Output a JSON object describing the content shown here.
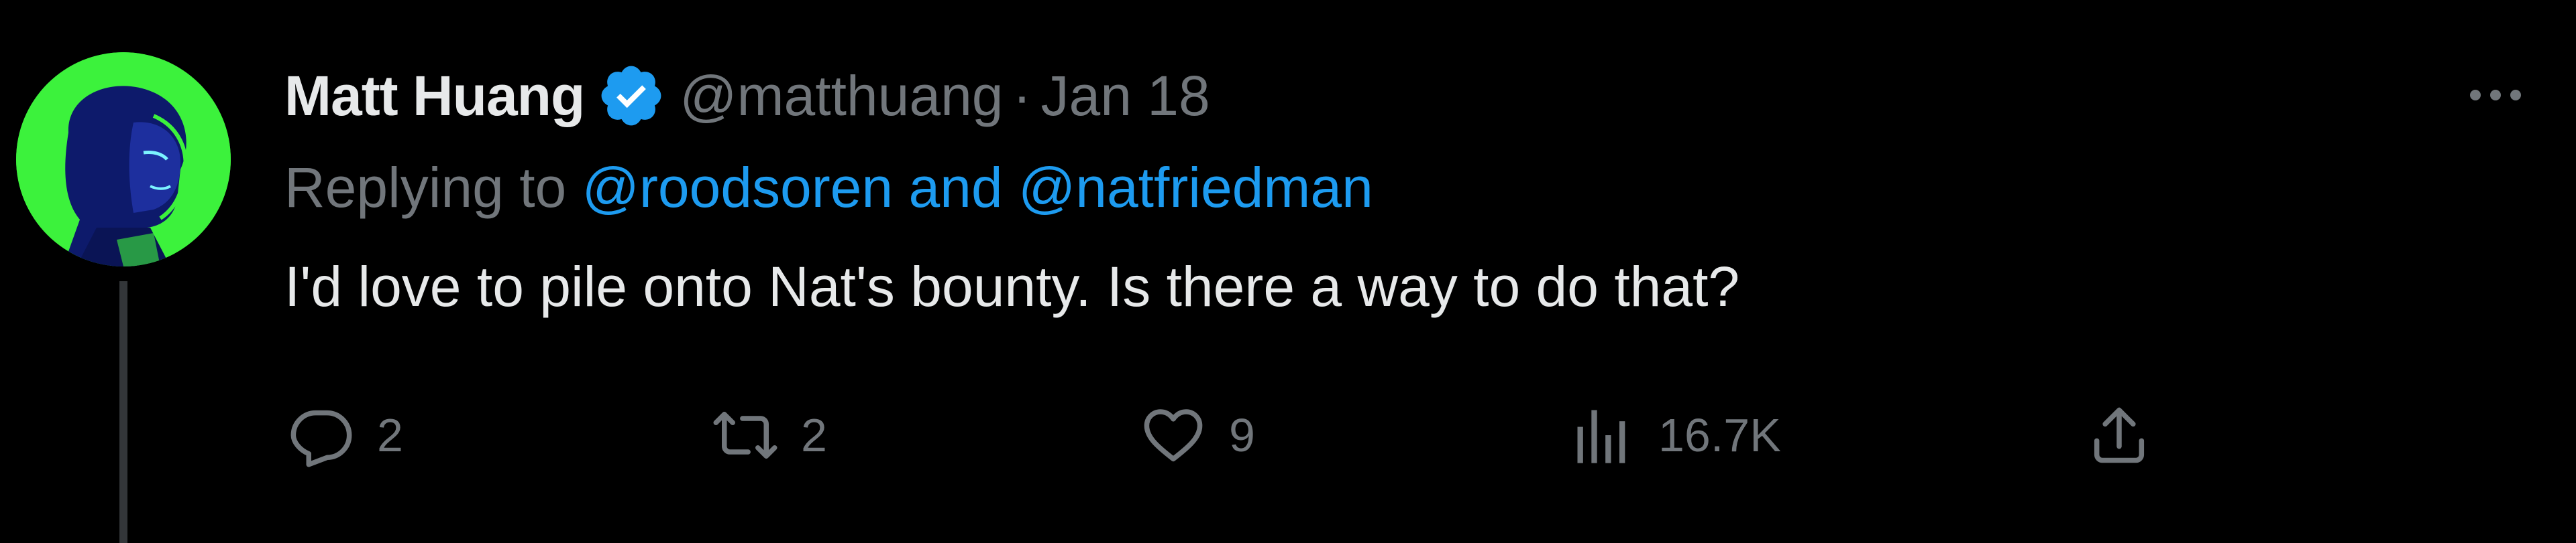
{
  "tweet": {
    "author_name": "Matt Huang",
    "handle": "@matthuang",
    "separator": "·",
    "date": "Jan 18",
    "replying_prefix": "Replying to ",
    "reply_mention_1": "@roodsoren",
    "reply_conjunction": " and ",
    "reply_mention_2": "@natfriedman",
    "text": "I'd love to pile onto Nat's bounty. Is there a way to do that?"
  },
  "actions": {
    "reply_count": "2",
    "retweet_count": "2",
    "like_count": "9",
    "view_count": "16.7K"
  },
  "icons": {
    "verified": "verified-badge-icon",
    "more": "more-icon",
    "reply": "reply-icon",
    "retweet": "retweet-icon",
    "like": "like-icon",
    "views": "views-icon",
    "share": "share-icon"
  },
  "colors": {
    "background": "#000000",
    "text_primary": "#e7e9ea",
    "text_secondary": "#71767b",
    "link": "#1d9bf0",
    "verified": "#1d9bf0",
    "avatar_bg": "#3cf23c"
  }
}
